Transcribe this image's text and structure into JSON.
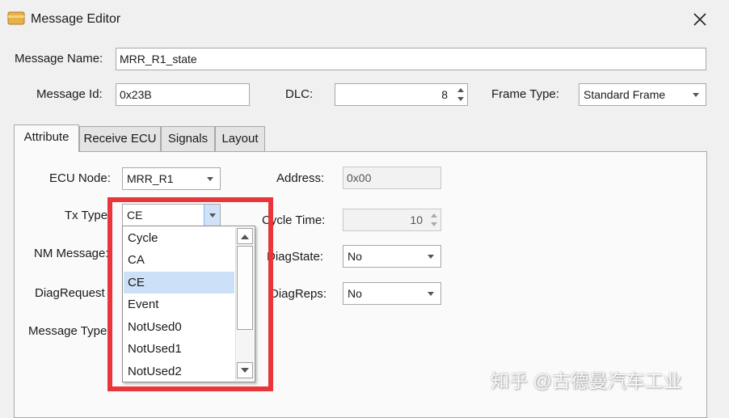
{
  "window": {
    "title": "Message Editor",
    "icon": "folder-icon",
    "close": "×"
  },
  "header": {
    "message_name": {
      "label": "Message Name:",
      "value": "MRR_R1_state"
    },
    "message_id": {
      "label": "Message Id:",
      "value": "0x23B"
    },
    "dlc": {
      "label": "DLC:",
      "value": "8"
    },
    "frame_type": {
      "label": "Frame Type:",
      "value": "Standard Frame"
    }
  },
  "tabs": [
    {
      "label": "Attribute",
      "active": true
    },
    {
      "label": "Receive ECU"
    },
    {
      "label": "Signals"
    },
    {
      "label": "Layout"
    }
  ],
  "attribute": {
    "ecu_node": {
      "label": "ECU Node:",
      "value": "MRR_R1"
    },
    "tx_type": {
      "label": "Tx Type",
      "value": "CE"
    },
    "nm_message": {
      "label": "NM Message:"
    },
    "diag_request": {
      "label": "DiagRequest"
    },
    "message_type": {
      "label": "Message Type"
    },
    "address": {
      "label": "Address:",
      "value": "0x00"
    },
    "cycle_time": {
      "label": "Cycle Time:",
      "value": "10"
    },
    "diag_state": {
      "label": "DiagState:",
      "value": "No"
    },
    "diag_reps": {
      "label": "DiagReps:",
      "value": "No"
    }
  },
  "tx_type_dropdown": {
    "options": [
      "Cycle",
      "CA",
      "CE",
      "Event",
      "NotUsed0",
      "NotUsed1",
      "NotUsed2"
    ],
    "selected": "CE"
  },
  "watermark": "知乎 @古德曼汽车工业",
  "colors": {
    "highlight": "#e8363a",
    "selection": "#cce0f7"
  }
}
